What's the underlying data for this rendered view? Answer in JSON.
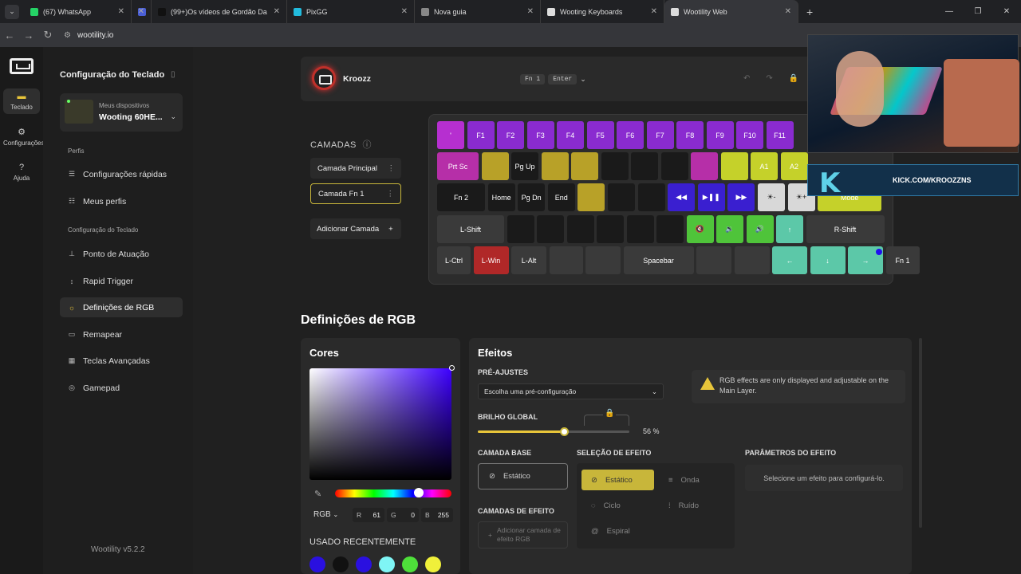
{
  "tabs": [
    {
      "label": "(67) WhatsApp",
      "color": "#25d366"
    },
    {
      "label": "",
      "color": "#4a5fd6"
    },
    {
      "label": "(99+)Os vídeos de Gordão Da",
      "color": "#111"
    },
    {
      "label": "PixGG",
      "color": "#2bd"
    },
    {
      "label": "Nova guia",
      "color": "#888"
    },
    {
      "label": "Wooting Keyboards",
      "color": "#ddd"
    },
    {
      "label": "Wootility Web",
      "color": "#ddd"
    }
  ],
  "url": "wootility.io",
  "leftnav": [
    {
      "label": "Teclado"
    },
    {
      "label": "Configurações"
    },
    {
      "label": "Ajuda"
    }
  ],
  "sidebar": {
    "title": "Configuração do Teclado",
    "device_sub": "Meus dispositivos",
    "device_name": "Wooting 60HE...",
    "section_profiles": "Perfis",
    "quick": "Configurações rápidas",
    "profiles": "Meus perfis",
    "section_config": "Configuração do Teclado",
    "actuation": "Ponto de Atuação",
    "rapid": "Rapid Trigger",
    "rgb": "Definições de RGB",
    "remap": "Remapear",
    "advanced": "Teclas Avançadas",
    "gamepad": "Gamepad",
    "version": "Wootility v5.2.2"
  },
  "header": {
    "profile": "Kroozz",
    "shortcut": [
      "Fn 1",
      "Enter"
    ]
  },
  "layers": {
    "title": "CAMADAS",
    "main": "Camada Principal",
    "fn1": "Camada Fn 1",
    "add": "Adicionar Camada"
  },
  "keyboard": {
    "rows": [
      [
        {
          "l": "'",
          "c": "#b62fd0"
        },
        {
          "l": "F1",
          "c": "#8a2bd0"
        },
        {
          "l": "F2",
          "c": "#8a2bd0"
        },
        {
          "l": "F3",
          "c": "#8a2bd0"
        },
        {
          "l": "F4",
          "c": "#8a2bd0"
        },
        {
          "l": "F5",
          "c": "#8a2bd0"
        },
        {
          "l": "F6",
          "c": "#8a2bd0"
        },
        {
          "l": "F7",
          "c": "#8a2bd0"
        },
        {
          "l": "F8",
          "c": "#8a2bd0"
        },
        {
          "l": "F9",
          "c": "#8a2bd0"
        },
        {
          "l": "F10",
          "c": "#8a2bd0"
        },
        {
          "l": "F11",
          "c": "#8a2bd0"
        }
      ],
      [
        {
          "l": "Prt Sc",
          "c": "#b62fa8"
        },
        {
          "l": "",
          "c": "#b8a128"
        },
        {
          "l": "Pg Up",
          "c": "#1a1a1a"
        },
        {
          "l": "",
          "c": "#b8a128"
        },
        {
          "l": "",
          "c": "#b8a128"
        },
        {
          "l": "",
          "c": "#1a1a1a"
        },
        {
          "l": "",
          "c": "#1a1a1a"
        },
        {
          "l": "",
          "c": "#1a1a1a"
        },
        {
          "l": "",
          "c": "#b62fa8"
        },
        {
          "l": "",
          "c": "#c5d12a"
        },
        {
          "l": "A1",
          "c": "#c5d12a"
        },
        {
          "l": "A2",
          "c": "#c5d12a"
        }
      ],
      [
        {
          "l": "Fn 2",
          "c": "#1a1a1a"
        },
        {
          "l": "Home",
          "c": "#1a1a1a"
        },
        {
          "l": "Pg Dn",
          "c": "#1a1a1a"
        },
        {
          "l": "End",
          "c": "#1a1a1a"
        },
        {
          "l": "",
          "c": "#b8a128"
        },
        {
          "l": "",
          "c": "#1a1a1a"
        },
        {
          "l": "",
          "c": "#1a1a1a"
        },
        {
          "l": "◀◀",
          "c": "#3a1fd0"
        },
        {
          "l": "▶❚❚",
          "c": "#3a1fd0"
        },
        {
          "l": "▶▶",
          "c": "#3a1fd0"
        },
        {
          "l": "☀-",
          "c": "#d8d8d8"
        },
        {
          "l": "☀+",
          "c": "#d8d8d8"
        },
        {
          "l": "Mode",
          "c": "#c5d12a"
        }
      ],
      [
        {
          "l": "L-Shift",
          "c": "#3a3a3a"
        },
        {
          "l": "",
          "c": "#1a1a1a"
        },
        {
          "l": "",
          "c": "#1a1a1a"
        },
        {
          "l": "",
          "c": "#1a1a1a"
        },
        {
          "l": "",
          "c": "#1a1a1a"
        },
        {
          "l": "",
          "c": "#1a1a1a"
        },
        {
          "l": "",
          "c": "#1a1a1a"
        },
        {
          "l": "🔇",
          "c": "#4fc43a"
        },
        {
          "l": "🔉",
          "c": "#4fc43a"
        },
        {
          "l": "🔊",
          "c": "#4fc43a"
        },
        {
          "l": "↑",
          "c": "#5cc8a8"
        },
        {
          "l": "R-Shift",
          "c": "#3a3a3a"
        }
      ],
      [
        {
          "l": "L-Ctrl",
          "c": "#3a3a3a"
        },
        {
          "l": "L-Win",
          "c": "#b02828"
        },
        {
          "l": "L-Alt",
          "c": "#3a3a3a"
        },
        {
          "l": "",
          "c": "#3a3a3a"
        },
        {
          "l": "",
          "c": "#3a3a3a"
        },
        {
          "l": "Spacebar",
          "c": "#3a3a3a"
        },
        {
          "l": "",
          "c": "#3a3a3a"
        },
        {
          "l": "",
          "c": "#3a3a3a"
        },
        {
          "l": "←",
          "c": "#5cc8a8"
        },
        {
          "l": "↓",
          "c": "#5cc8a8"
        },
        {
          "l": "→",
          "c": "#5cc8a8"
        },
        {
          "l": "Fn 1",
          "c": "#3a3a3a"
        }
      ]
    ]
  },
  "rgb": {
    "title": "Definições de RGB",
    "colors_title": "Cores",
    "mode": "RGB",
    "r": "61",
    "g": "0",
    "b": "255",
    "recent": "USADO RECENTEMENTE",
    "swatches": [
      "#2a10e0",
      "#111111",
      "#2a10e0",
      "#7ff5f5",
      "#4ee03a",
      "#f0f03a"
    ],
    "effects_title": "Efeitos",
    "presets_label": "PRÉ-AJUSTES",
    "presets_placeholder": "Escolha uma pré-configuração",
    "note": "RGB effects are only displayed and adjustable on the Main Layer.",
    "brightness_label": "BRILHO GLOBAL",
    "brightness": 56,
    "brightness_text": "56 %",
    "base_label": "CAMADA BASE",
    "base_value": "Estático",
    "effect_layers_label": "CAMADAS DE EFEITO",
    "add_effect": "Adicionar camada de efeito RGB",
    "select_label": "SELEÇÃO DE EFEITO",
    "effects": [
      "Estático",
      "Onda",
      "Ciclo",
      "Ruído",
      "Espiral"
    ],
    "params_label": "PARÂMETROS DO EFEITO",
    "params_hint": "Selecione um efeito para configurá-lo."
  },
  "stream": {
    "kick": "KICK.COM/KROOZZNS"
  }
}
